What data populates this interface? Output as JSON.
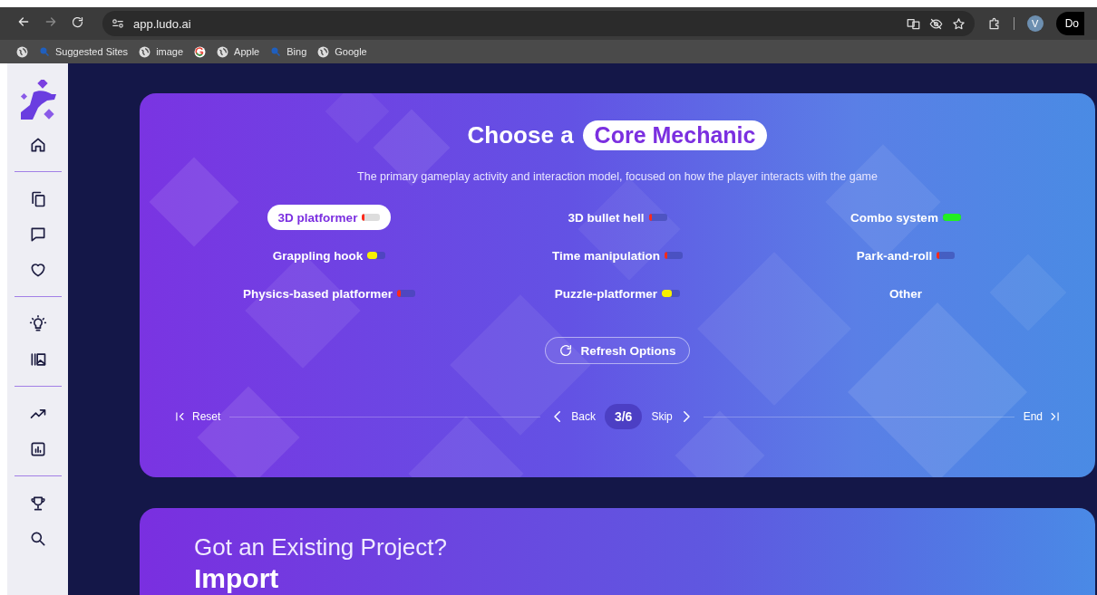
{
  "browser": {
    "url": "app.ludo.ai",
    "profile_initial": "V",
    "profile_button": "Do",
    "bookmarks": [
      {
        "label": "Suggested Sites",
        "kind": "search"
      },
      {
        "label": "image",
        "kind": "globe"
      },
      {
        "kind": "google"
      },
      {
        "label": "Apple",
        "kind": "globe"
      },
      {
        "label": "Bing",
        "kind": "search"
      },
      {
        "label": "Google",
        "kind": "globe"
      }
    ]
  },
  "card": {
    "title": "Choose a",
    "highlight": "Core Mechanic",
    "subtitle": "The primary gameplay activity and interaction model, focused on how the player interacts with the game",
    "options": [
      {
        "label": "3D platformer",
        "selected": true,
        "meter": {
          "level": 0.15,
          "color": "#ff2a1a"
        }
      },
      {
        "label": "3D bullet hell",
        "selected": false,
        "meter": {
          "level": 0.15,
          "color": "#ff2a1a"
        }
      },
      {
        "label": "Combo system",
        "selected": false,
        "meter": {
          "level": 1,
          "color": "#22ee22"
        }
      },
      {
        "label": "Grappling hook",
        "selected": false,
        "meter": {
          "level": 0.55,
          "color": "#f7f000"
        }
      },
      {
        "label": "Time manipulation",
        "selected": false,
        "meter": {
          "level": 0.15,
          "color": "#ff2a1a"
        }
      },
      {
        "label": "Park-and-roll",
        "selected": false,
        "meter": {
          "level": 0.1,
          "color": "#ff2a1a"
        }
      },
      {
        "label": "Physics-based platformer",
        "selected": false,
        "meter": {
          "level": 0.2,
          "color": "#ff2a1a"
        }
      },
      {
        "label": "Puzzle-platformer",
        "selected": false,
        "meter": {
          "level": 0.55,
          "color": "#f7f000"
        }
      },
      {
        "label": "Other",
        "selected": false
      }
    ],
    "refresh": "Refresh Options",
    "nav": {
      "reset": "Reset",
      "back": "Back",
      "step": "3/6",
      "skip": "Skip",
      "end": "End"
    }
  },
  "import_card": {
    "title": "Got an Existing Project?",
    "heading": "Import"
  }
}
